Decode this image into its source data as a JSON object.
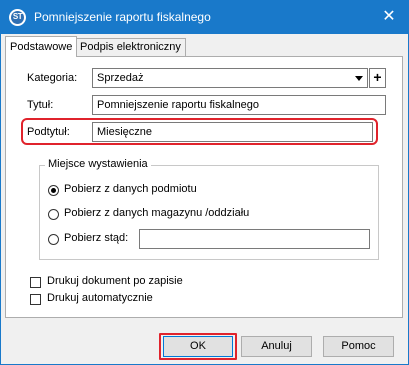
{
  "window": {
    "title": "Pomniejszenie raportu fiskalnego",
    "app_icon_text": "ST",
    "close_glyph": "✕"
  },
  "tabs": [
    {
      "label": "Podstawowe",
      "active": true
    },
    {
      "label": "Podpis elektroniczny",
      "active": false
    }
  ],
  "form": {
    "category_label": "Kategoria:",
    "category_value": "Sprzedaż",
    "add_glyph": "+",
    "title_label": "Tytuł:",
    "title_value": "Pomniejszenie raportu fiskalnego",
    "subtitle_label": "Podtytuł:",
    "subtitle_value": "Miesięczne"
  },
  "issue_place": {
    "legend": "Miejsce wystawienia",
    "options": [
      {
        "label": "Pobierz z danych podmiotu",
        "selected": true
      },
      {
        "label": "Pobierz z danych magazynu /oddziału",
        "selected": false
      },
      {
        "label": "Pobierz stąd:",
        "selected": false
      }
    ],
    "custom_value": ""
  },
  "options": {
    "print_after_save": {
      "label": "Drukuj dokument po zapisie",
      "checked": false
    },
    "print_auto": {
      "label": "Drukuj automatycznie",
      "checked": false
    }
  },
  "buttons": {
    "ok": "OK",
    "cancel": "Anuluj",
    "help": "Pomoc"
  },
  "colors": {
    "titlebar": "#1979ca",
    "highlight": "#e0232c"
  },
  "icons": {
    "app": "app-logo-icon",
    "close": "close-icon",
    "combo": "chevron-down-icon"
  }
}
